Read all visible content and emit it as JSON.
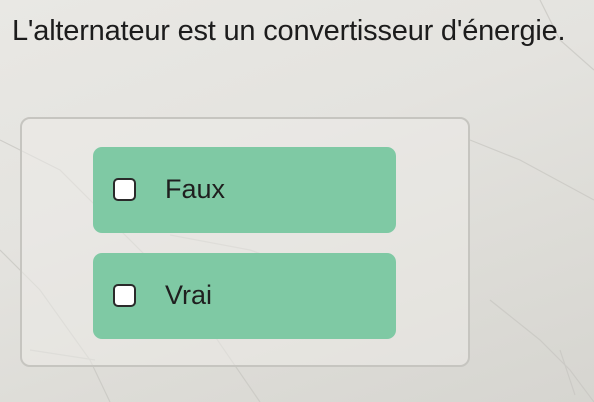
{
  "quiz": {
    "question": "L'alternateur est un convertisseur d'énergie.",
    "options": [
      {
        "label": "Faux",
        "checked": false
      },
      {
        "label": "Vrai",
        "checked": false
      }
    ]
  },
  "colors": {
    "option_background": "#7fc9a4",
    "checkbox_background": "#ffffff",
    "checkbox_border": "#2a2a2a",
    "text": "#1c1c1c"
  }
}
